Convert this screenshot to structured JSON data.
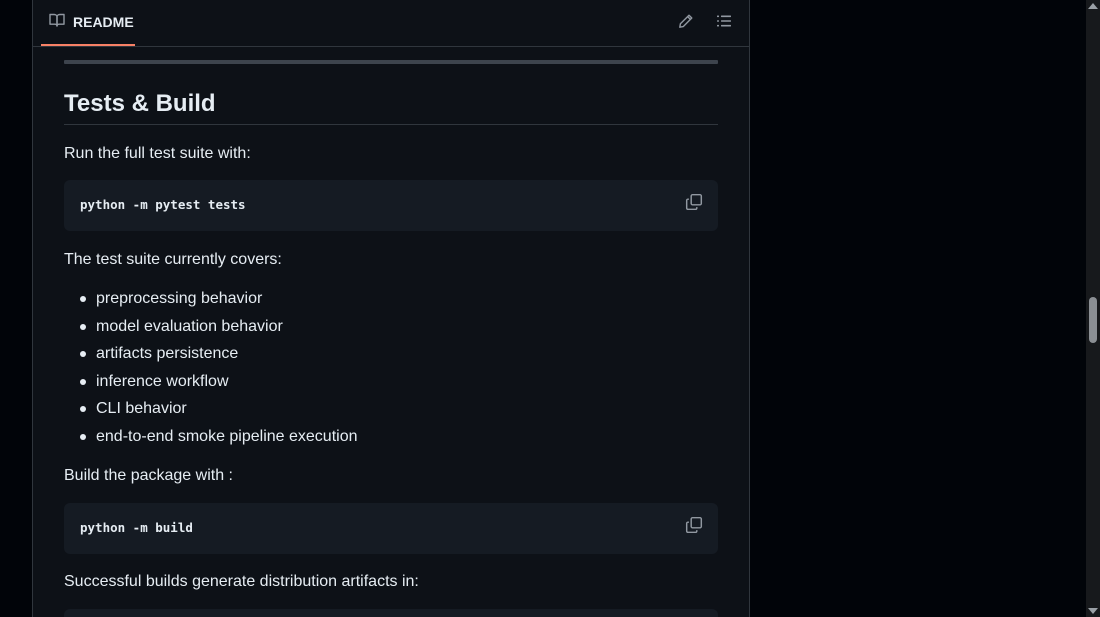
{
  "readme": {
    "tab_label": "README",
    "icons": {
      "tab": "book-icon",
      "edit": "pencil-icon",
      "toc": "list-icon"
    }
  },
  "section": {
    "title": "Tests & Build",
    "intro": "Run the full test suite with:",
    "test_command": "python -m pytest tests",
    "covers_intro": "The test suite currently covers:",
    "covers": [
      "preprocessing behavior",
      "model evaluation behavior",
      "artifacts persistence",
      "inference workflow",
      "CLI behavior",
      "end-to-end smoke pipeline execution"
    ],
    "build_intro": "Build the package with :",
    "build_command": "python -m build",
    "artifacts_intro": "Successful builds generate distribution artifacts in:"
  },
  "colors": {
    "page_bg": "#0d1117",
    "outer_bg": "#010409",
    "code_bg": "#151b23",
    "tab_accent": "#f78166",
    "text": "#e6edf3",
    "muted": "#9198a1"
  }
}
